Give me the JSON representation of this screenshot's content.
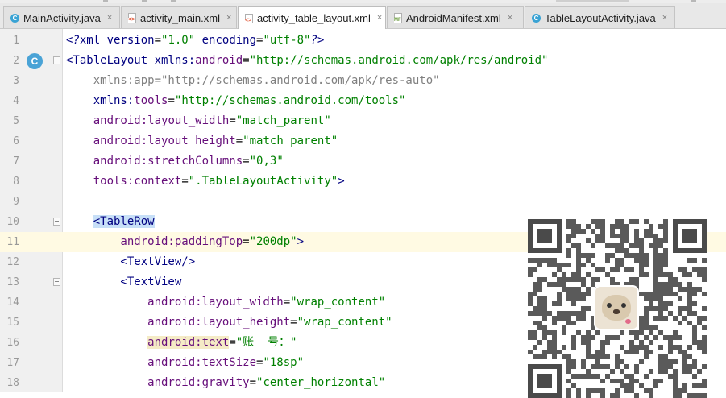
{
  "tabs": [
    {
      "label": "MainActivity.java",
      "icon": "java-class-icon",
      "active": false
    },
    {
      "label": "activity_main.xml",
      "icon": "xml-file-icon",
      "active": false
    },
    {
      "label": "activity_table_layout.xml",
      "icon": "xml-file-icon",
      "active": true
    },
    {
      "label": "AndroidManifest.xml",
      "icon": "manifest-file-icon",
      "active": false
    },
    {
      "label": "TableLayoutActivity.java",
      "icon": "java-class-icon",
      "active": false
    }
  ],
  "tab_close_glyph": "×",
  "gutter_class_marker": "C",
  "lines": [
    {
      "n": "1",
      "segs": [
        {
          "t": "<?",
          "c": "c-proc"
        },
        {
          "t": "xml version",
          "c": "c-attr"
        },
        {
          "t": "=",
          "c": "c-text"
        },
        {
          "t": "\"1.0\"",
          "c": "c-val"
        },
        {
          "t": " encoding",
          "c": "c-attr"
        },
        {
          "t": "=",
          "c": "c-text"
        },
        {
          "t": "\"utf-8\"",
          "c": "c-val"
        },
        {
          "t": "?>",
          "c": "c-proc"
        }
      ]
    },
    {
      "n": "2",
      "segs": [
        {
          "t": "<TableLayout ",
          "c": "c-tag"
        },
        {
          "t": "xmlns:",
          "c": "c-attr"
        },
        {
          "t": "android",
          "c": "c-attr-ns"
        },
        {
          "t": "=",
          "c": "c-text"
        },
        {
          "t": "\"http://schemas.android.com/apk/res/android\"",
          "c": "c-val"
        }
      ]
    },
    {
      "n": "3",
      "segs": [
        {
          "t": "    xmlns:app=\"http://schemas.android.com/apk/res-auto\"",
          "c": "c-faded"
        }
      ]
    },
    {
      "n": "4",
      "segs": [
        {
          "t": "    xmlns:",
          "c": "c-attr"
        },
        {
          "t": "tools",
          "c": "c-attr-ns"
        },
        {
          "t": "=",
          "c": "c-text"
        },
        {
          "t": "\"http://schemas.android.com/tools\"",
          "c": "c-val"
        }
      ]
    },
    {
      "n": "5",
      "segs": [
        {
          "t": "    android:",
          "c": "c-attr-ns"
        },
        {
          "t": "layout_width",
          "c": "c-attr-ns"
        },
        {
          "t": "=",
          "c": "c-text"
        },
        {
          "t": "\"match_parent\"",
          "c": "c-val"
        }
      ]
    },
    {
      "n": "6",
      "segs": [
        {
          "t": "    android:",
          "c": "c-attr-ns"
        },
        {
          "t": "layout_height",
          "c": "c-attr-ns"
        },
        {
          "t": "=",
          "c": "c-text"
        },
        {
          "t": "\"match_parent\"",
          "c": "c-val"
        }
      ]
    },
    {
      "n": "7",
      "segs": [
        {
          "t": "    android:",
          "c": "c-attr-ns"
        },
        {
          "t": "stretchColumns",
          "c": "c-attr-ns"
        },
        {
          "t": "=",
          "c": "c-text"
        },
        {
          "t": "\"0,3\"",
          "c": "c-val"
        }
      ]
    },
    {
      "n": "8",
      "segs": [
        {
          "t": "    tools:",
          "c": "c-attr-ns"
        },
        {
          "t": "context",
          "c": "c-attr-ns"
        },
        {
          "t": "=",
          "c": "c-text"
        },
        {
          "t": "\".TableLayoutActivity\"",
          "c": "c-val"
        },
        {
          "t": ">",
          "c": "c-tag"
        }
      ]
    },
    {
      "n": "9",
      "segs": []
    },
    {
      "n": "10",
      "segs": [
        {
          "t": "    ",
          "c": "c-text"
        },
        {
          "t": "<TableRow",
          "c": "c-tag hl-tag"
        }
      ]
    },
    {
      "n": "11",
      "caret": true,
      "segs": [
        {
          "t": "        android:",
          "c": "c-attr-ns"
        },
        {
          "t": "paddingTop",
          "c": "c-attr-ns"
        },
        {
          "t": "=",
          "c": "c-text"
        },
        {
          "t": "\"200dp\"",
          "c": "c-val"
        },
        {
          "t": ">",
          "c": "c-tag"
        }
      ]
    },
    {
      "n": "12",
      "segs": [
        {
          "t": "        <TextView/>",
          "c": "c-tag"
        }
      ]
    },
    {
      "n": "13",
      "segs": [
        {
          "t": "        <TextView",
          "c": "c-tag"
        }
      ]
    },
    {
      "n": "14",
      "segs": [
        {
          "t": "            android:",
          "c": "c-attr-ns"
        },
        {
          "t": "layout_width",
          "c": "c-attr-ns"
        },
        {
          "t": "=",
          "c": "c-text"
        },
        {
          "t": "\"wrap_content\"",
          "c": "c-val"
        }
      ]
    },
    {
      "n": "15",
      "segs": [
        {
          "t": "            android:",
          "c": "c-attr-ns"
        },
        {
          "t": "layout_height",
          "c": "c-attr-ns"
        },
        {
          "t": "=",
          "c": "c-text"
        },
        {
          "t": "\"wrap_content\"",
          "c": "c-val"
        }
      ]
    },
    {
      "n": "16",
      "segs": [
        {
          "t": "            ",
          "c": "c-text"
        },
        {
          "t": "android:text",
          "c": "c-attr-ns hl-attr"
        },
        {
          "t": "=",
          "c": "c-text"
        },
        {
          "t": "\"账  号：\"",
          "c": "c-val"
        }
      ]
    },
    {
      "n": "17",
      "segs": [
        {
          "t": "            android:",
          "c": "c-attr-ns"
        },
        {
          "t": "textSize",
          "c": "c-attr-ns"
        },
        {
          "t": "=",
          "c": "c-text"
        },
        {
          "t": "\"18sp\"",
          "c": "c-val"
        }
      ]
    },
    {
      "n": "18",
      "segs": [
        {
          "t": "            android:",
          "c": "c-attr-ns"
        },
        {
          "t": "gravity",
          "c": "c-attr-ns"
        },
        {
          "t": "=",
          "c": "c-text"
        },
        {
          "t": "\"center_horizontal\"",
          "c": "c-val"
        }
      ]
    }
  ],
  "colors": {
    "tag": "#000080",
    "attribute_namespace": "#660e7a",
    "value": "#008000",
    "unused_attribute": "#808080",
    "caret_row": "#fffae3",
    "matched_tag_highlight": "#c7dff7",
    "class_marker": "#4aa3d6"
  },
  "overlay": {
    "type": "qr-code-with-pug-avatar"
  }
}
